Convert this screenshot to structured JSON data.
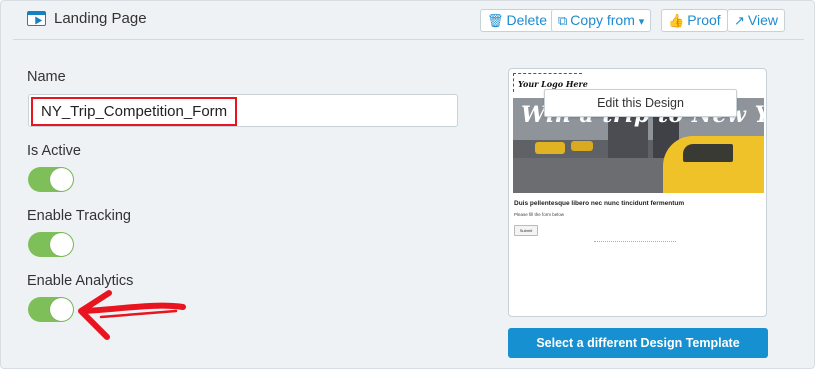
{
  "header": {
    "title": "Landing Page",
    "icon": "landing-page-icon",
    "actions": {
      "delete": {
        "label": "Delete",
        "icon": "trash-icon"
      },
      "copy_from": {
        "label": "Copy from",
        "icon": "copy-icon",
        "caret": "▾"
      },
      "proof": {
        "label": "Proof",
        "icon": "thumbs-up-icon"
      },
      "view": {
        "label": "View",
        "icon": "external-link-icon"
      }
    }
  },
  "form": {
    "name_label": "Name",
    "name_value": "NY_Trip_Competition_Form",
    "is_active_label": "Is Active",
    "is_active": true,
    "enable_tracking_label": "Enable Tracking",
    "enable_tracking": true,
    "enable_analytics_label": "Enable Analytics",
    "enable_analytics": true
  },
  "preview": {
    "logo_text": "Your Logo Here",
    "hero_title": "Win a trip to New York!",
    "edit_label": "Edit this Design",
    "heading": "Duis pellentesque libero nec nunc tincidunt fermentum",
    "line_text": "Please fill the form below",
    "submit_label": "Submit"
  },
  "select_template_label": "Select a different Design Template",
  "colors": {
    "accent": "#1690d0",
    "toggle_on": "#7fbf59",
    "highlight": "#e8141f"
  }
}
